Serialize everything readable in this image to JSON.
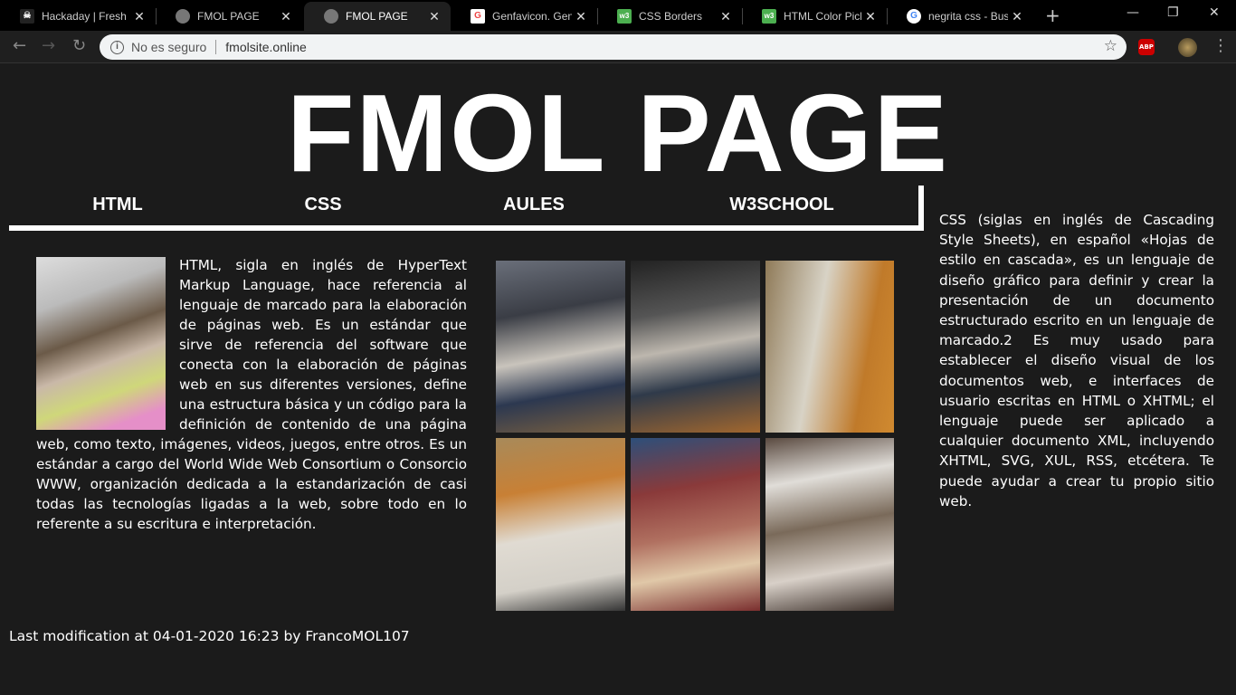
{
  "browser": {
    "tabs": [
      {
        "title": "Hackaday | Fresh H",
        "icon": "hackaday-icon"
      },
      {
        "title": "FMOL PAGE",
        "icon": "globe-icon"
      },
      {
        "title": "FMOL PAGE",
        "icon": "globe-icon",
        "active": true
      },
      {
        "title": "Genfavicon. Genera",
        "icon": "genfavicon-icon"
      },
      {
        "title": "CSS Borders",
        "icon": "w3schools-icon"
      },
      {
        "title": "HTML Color Picker",
        "icon": "w3schools-icon"
      },
      {
        "title": "negrita css - Busca",
        "icon": "google-icon"
      }
    ],
    "security_label": "No es seguro",
    "url": "fmolsite.online",
    "abp_label": "ABP"
  },
  "page": {
    "title": "FMOL PAGE",
    "nav": [
      "HTML",
      "CSS",
      "AULES",
      "W3SCHOOL"
    ],
    "html_text": "HTML, sigla en inglés de HyperText Markup Language, hace referencia al lenguaje de marcado para la elaboración de páginas web. Es un estándar que sirve de referencia del software que conecta con la elaboración de páginas web en sus diferentes versiones, define una estructura básica y un código para la definición de contenido de una página web, como texto, imágenes, videos, juegos, entre otros. Es un estándar a cargo del World Wide Web Consortium o Consorcio WWW, organización dedicada a la estandarización de casi todas las tecnologías ligadas a la web, sobre todo en lo referente a su escritura e interpretación.",
    "css_text": "CSS (siglas en inglés de Cascading Style Sheets), en español «Hojas de estilo en cascada», es un lenguaje de diseño gráfico para definir y crear la presentación de un documento estructurado escrito en un lenguaje de marcado.2 Es muy usado para establecer el diseño visual de los documentos web, e interfaces de usuario escritas en HTML o XHTML; el lenguaje puede ser aplicado a cualquier documento XML, incluyendo XHTML, SVG, XUL, RSS, etcétera. Te puede ayudar a crear tu propio sitio web.",
    "footer": "Last modification at 04-01-2020 16:23 by FrancoMOL107"
  }
}
